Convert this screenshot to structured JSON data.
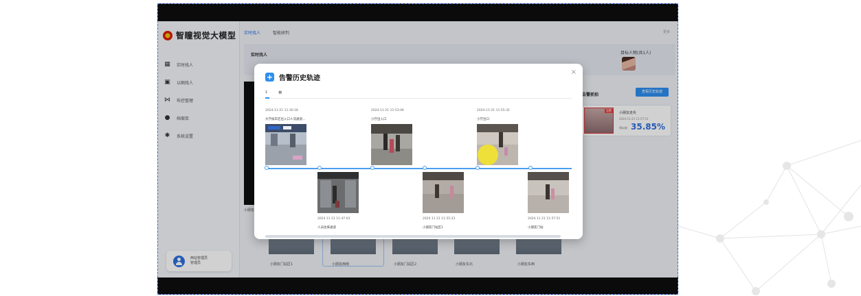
{
  "app": {
    "title": "智瞳视觉大模型"
  },
  "sidebar": {
    "items": [
      {
        "label": "实时找人",
        "icon": "grid-icon"
      },
      {
        "label": "以图找人",
        "icon": "image-icon"
      },
      {
        "label": "布控管理",
        "icon": "network-icon"
      },
      {
        "label": "档案库",
        "icon": "person-icon"
      },
      {
        "label": "系统设置",
        "icon": "gear-icon"
      }
    ],
    "user": {
      "name": "西站管理员",
      "role": "管理员"
    }
  },
  "top_tabs": [
    {
      "label": "实时找人",
      "active": true
    },
    {
      "label": "智能研判",
      "active": false
    }
  ],
  "top_more": "更多",
  "main": {
    "panel_title": "实时找人",
    "target_label": "目标人物(共1人)",
    "left_caption": "小朋友",
    "alarm": {
      "heading": "告警抓拍",
      "button": "查看历史轨迹",
      "tag": "告警",
      "title": "小朋友走失",
      "time": "2024-11-21 11:57:51",
      "score_label": "相似度",
      "score": "35.85%"
    },
    "bottom_thumbs": [
      "小朋友门站区1",
      "小朋友西南",
      "小朋友门站区2",
      "小朋友东北",
      "小朋友东西"
    ]
  },
  "modal": {
    "title": "告警历史轨迹",
    "close": "×",
    "tabs": [
      "1",
      "带"
    ],
    "top_events": [
      {
        "time": "2024-11-21 11:30:18",
        "location": "大厅候车区出入口人流通道..."
      },
      {
        "time": "2024-11-21 11:53:06",
        "location": "小厅出入口"
      },
      {
        "time": "2024-11-21 11:55:32",
        "location": "小厅出口"
      }
    ],
    "bottom_events": [
      {
        "time": "2024 11 21 11:47:03",
        "location": "人员往来通道"
      },
      {
        "time": "2024 11 21 11:55:23",
        "location": "小朋友门站区1"
      },
      {
        "time": "2024 11 21 11:57:51",
        "location": "小朋友门站"
      }
    ]
  }
}
